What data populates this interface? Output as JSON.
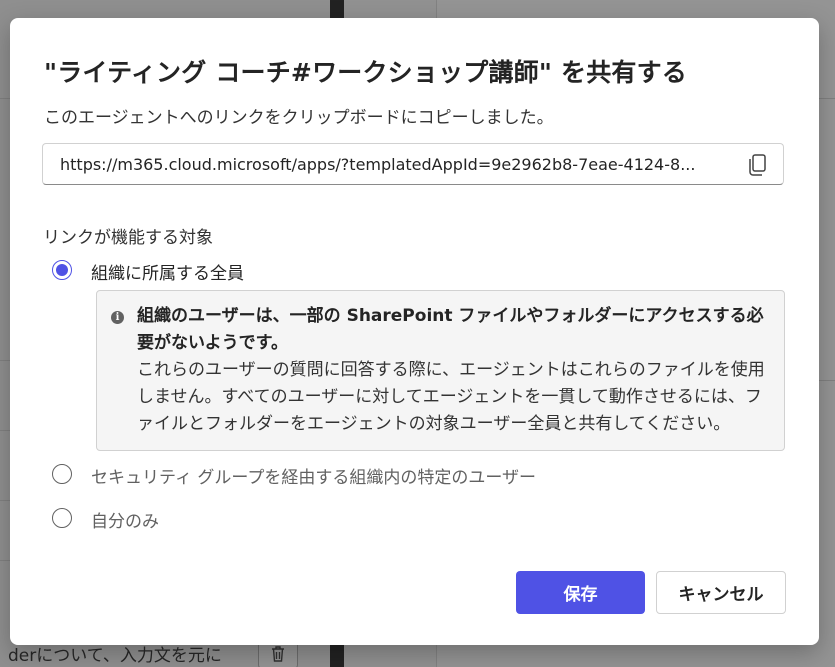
{
  "background": {
    "bottom_text": "derについて、入力文を元に",
    "trash_icon": "trash-icon"
  },
  "dialog": {
    "title": "\"ライティング コーチ#ワークショップ講師\" を共有する",
    "subtitle": "このエージェントへのリンクをクリップボードにコピーしました。",
    "link": {
      "value": "https://m365.cloud.microsoft/apps/?templatedAppId=9e2962b8-7eae-4124-8...",
      "copy_icon": "copy-icon"
    },
    "section_label": "リンクが機能する対象",
    "options": [
      {
        "label": "組織に所属する全員",
        "checked": true
      },
      {
        "label": "セキュリティ グループを経由する組織内の特定のユーザー",
        "checked": false
      },
      {
        "label": "自分のみ",
        "checked": false
      }
    ],
    "info": {
      "icon": "info-icon",
      "title": "組織のユーザーは、一部の SharePoint ファイルやフォルダーにアクセスする必要がないようです。",
      "body": "これらのユーザーの質問に回答する際に、エージェントはこれらのファイルを使用しません。すべてのユーザーに対してエージェントを一貫して動作させるには、ファイルとフォルダーをエージェントの対象ユーザー全員と共有してください。"
    },
    "buttons": {
      "save": "保存",
      "cancel": "キャンセル"
    },
    "accent_color": "#4f52e5"
  }
}
